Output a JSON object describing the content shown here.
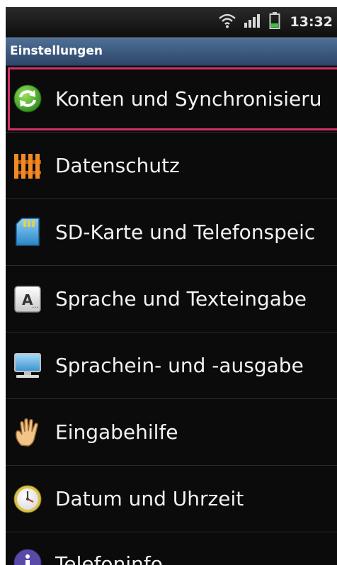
{
  "status_bar": {
    "time": "13:32",
    "icons": [
      "wifi-icon",
      "signal-icon",
      "battery-icon"
    ],
    "battery_color": "#39c43c"
  },
  "title_bar": {
    "title": "Einstellungen"
  },
  "settings": {
    "items": [
      {
        "label": "Konten und Synchronisieru",
        "icon": "sync-icon",
        "selected": true
      },
      {
        "label": "Datenschutz",
        "icon": "fence-icon"
      },
      {
        "label": "SD-Karte und Telefonspeic",
        "icon": "sd-card-icon"
      },
      {
        "label": "Sprache und Texteingabe",
        "icon": "keyboard-key-icon"
      },
      {
        "label": "Sprachein- und -ausgabe",
        "icon": "monitor-icon"
      },
      {
        "label": "Eingabehilfe",
        "icon": "hand-icon"
      },
      {
        "label": "Datum und Uhrzeit",
        "icon": "clock-icon"
      },
      {
        "label": "Telefoninfo",
        "icon": "info-icon"
      }
    ]
  },
  "colors": {
    "background": "#0b0b0b",
    "title_bar": "#3d5a80",
    "selection": "#d2306c",
    "text": "#f2f2f2"
  }
}
